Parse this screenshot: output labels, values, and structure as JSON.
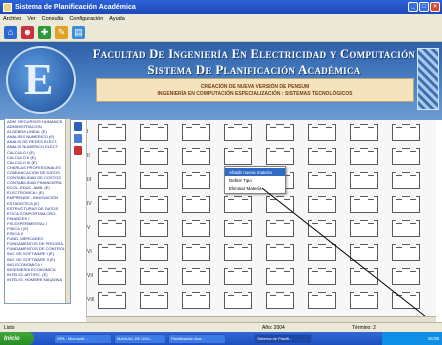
{
  "window": {
    "title": "Sistema de Planificación Académica"
  },
  "menu": [
    "Archivo",
    "Ver",
    "Consulta",
    "Configuración",
    "Ayuda"
  ],
  "banner": {
    "line1": "Facultad De Ingeniería En Electricidad y Computación",
    "line2": "Sistema De Planificación Académica",
    "sub1": "CREACIÓN DE NUEVA VERSIÓN DE PENSUM",
    "sub2": "INGENIERÍA EN COMPUTACIÓN ESPECIALIZACIÓN : SISTEMAS TECNOLÓGICOS"
  },
  "sidebar_items": [
    "ADM. RECURSOS HUMANOS",
    "ADMINISTRACION",
    "ALGEBRA LINEAL (E)",
    "ANALISIS NUMERICO (E)",
    "ANALIS DE REDES ELECT.",
    "ANALIS NUMERICO ELECT.",
    "CALCULO I (E)",
    "CALCULO II (E)",
    "CALCULO III (E)",
    "CHARLAS PROFESIONALES",
    "COMUNICACION DE DATOS",
    "CONTABILIDAD DE COSTOS",
    "CONTABILIDAD FINANCIERA",
    "ECOL. EDUC. AMB. (E)",
    "ELECTRONICA I (E)",
    "EMPRENDE., INNOVACION",
    "ESTADISTICA (E)",
    "ESTRUCTURAS DE DATOS",
    "ETICA CONPORTAM.ORG.",
    "FINANCES I",
    "FIS.EXPERIMENTAL I",
    "FISICA I (E)",
    "FISICA II",
    "FUND. MERCADEO",
    "FUNDAMENTOS DE PROGRA.",
    "FUNDAMENTOS DE CONTROL",
    "ING. DE SOFTWARE I (E)",
    "ING. DE SOFTWARE II (E)",
    "ING.ECONOMICA I",
    "INGENIERIA ECONOMICA",
    "INTELIG. ARTIFIC. (E)",
    "INTELIG. HOMBRE MAQUINA"
  ],
  "row_labels": [
    "I",
    "II",
    "III",
    "IV",
    "V",
    "VI",
    "VII",
    "VIII"
  ],
  "context_menu": [
    "Añadir nueva materia",
    "Definir Tipo",
    "Eliminar Materia"
  ],
  "status": {
    "left": "Listo",
    "year": "Año: 2004",
    "term": "Término: 2"
  },
  "taskbar": {
    "start": "Inicio",
    "tasks": [
      "SPA - Microsoft ...",
      "MANUAL DE USU...",
      "Planificación Aca...",
      "Sistema de Planifi..."
    ],
    "clock": "16:05"
  }
}
